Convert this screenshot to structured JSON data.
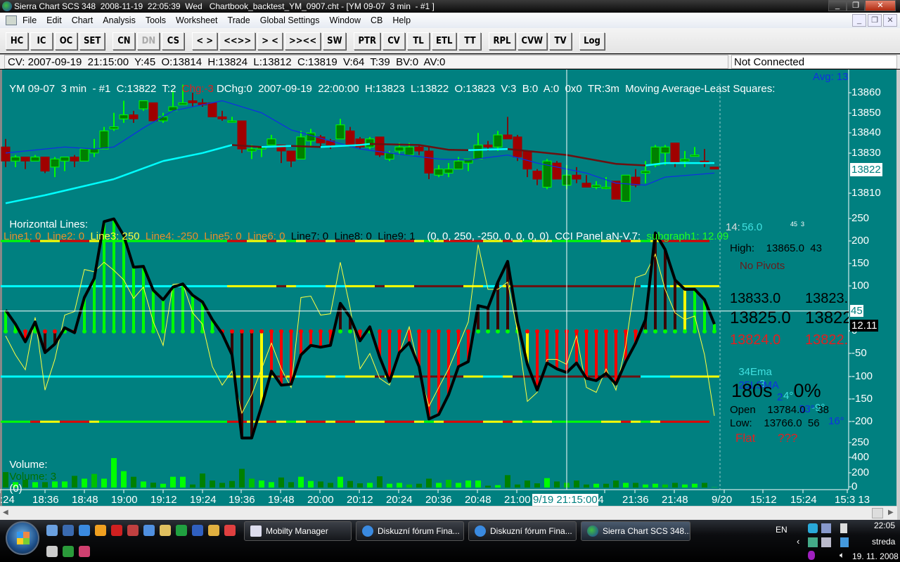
{
  "window": {
    "title": "Sierra Chart SCS 348  2008-11-19  22:05:39  Wed   Chartbook_backtest_YM_0907.cht - [YM 09-07  3 min  - #1 ]",
    "buttons": {
      "minimize": "_",
      "restore": "❐",
      "close": "✕"
    }
  },
  "menu": [
    "File",
    "Edit",
    "Chart",
    "Analysis",
    "Tools",
    "Worksheet",
    "Trade",
    "Global Settings",
    "Window",
    "CB",
    "Help"
  ],
  "mdi_buttons": [
    "_",
    "❐",
    "✕"
  ],
  "toolbar": [
    {
      "label": "HC"
    },
    {
      "label": "IC"
    },
    {
      "label": "OC"
    },
    {
      "label": "SET"
    },
    {
      "label": "CN",
      "group": true
    },
    {
      "label": "DN",
      "disabled": true
    },
    {
      "label": "CS"
    },
    {
      "label": "< >",
      "group": true
    },
    {
      "label": "<<>>"
    },
    {
      "label": "> <"
    },
    {
      "label": ">><<"
    },
    {
      "label": "SW"
    },
    {
      "label": "PTR",
      "group": true
    },
    {
      "label": "CV"
    },
    {
      "label": "TL"
    },
    {
      "label": "ETL"
    },
    {
      "label": "TT"
    },
    {
      "label": "RPL",
      "group": true
    },
    {
      "label": "CVW"
    },
    {
      "label": "TV"
    },
    {
      "label": "Log",
      "group": true
    }
  ],
  "infobar": {
    "cursor_values": "CV: 2007-09-19  21:15:00  Y:45  O:13814  H:13824  L:13812  C:13819  V:64  T:39  BV:0  AV:0",
    "connection_status": "Not Connected"
  },
  "price_header": {
    "main": "YM 09-07  3 min  - #1  C:13822  T:2  ",
    "change": "Chg:-3",
    "rest": " DChg:0  2007-09-19  22:00:00  H:13823  L:13822  O:13823  V:3  B:0  A:0  0x0  TR:3m  Moving Average-Least Squares:  ",
    "avg": "Avg: 13"
  },
  "cci_header": {
    "label": "Horizontal Lines:  ",
    "lines": [
      {
        "text": "Line1: 0",
        "color": "#e8902a"
      },
      {
        "text": "Line2: 0",
        "color": "#e8902a"
      },
      {
        "text": "Line3: 250",
        "color": "#ffff40"
      },
      {
        "text": "Line4: -250",
        "color": "#e8902a"
      },
      {
        "text": "Line5: 0",
        "color": "#e8902a"
      },
      {
        "text": "Line6: 0",
        "color": "#e8902a"
      },
      {
        "text": "Line7: 0",
        "color": "#000000"
      },
      {
        "text": "Line8: 0",
        "color": "#000000"
      },
      {
        "text": "Line9: 1",
        "color": "#000000"
      }
    ],
    "tuple": "(0, 0, 250, -250, 0, 0, 0, 0)",
    "panel": "CCI Panel aN-V.7:",
    "subgraph": "subgraph1: 12.09"
  },
  "volume_header": {
    "label": "Volume:",
    "series": "Volume: 3",
    "extra": "(0)"
  },
  "overlay": {
    "timer_a": "14:",
    "timer_b": "56.0",
    "small": "45  3",
    "high": "High:    13865.0  43",
    "pivots": "No Pivots",
    "row1": [
      "13833.0",
      "13823."
    ],
    "row2": [
      "13825.0",
      "13822"
    ],
    "row3": [
      "13824.0",
      "13822."
    ],
    "ema": [
      "34Ema",
      "-3",
      "4°",
      "-9°"
    ],
    "lsma": [
      "25LSMA",
      "2",
      "33°",
      "16°"
    ],
    "timer": "180s    0%",
    "open": "Open    13784.0    38",
    "low": "Low:    13766.0  56",
    "flat": [
      "Flat",
      "???"
    ]
  },
  "axes": {
    "price_ticks": [
      "13860",
      "13850",
      "13840",
      "13830",
      "13810"
    ],
    "price_marker": "13822",
    "cci_ticks": [
      "250",
      "200",
      "150",
      "100",
      "0",
      "-50",
      "-100",
      "-150",
      "-200",
      "250"
    ],
    "cci_cursor_marker": "45",
    "cci_value_marker": "12.11",
    "volume_ticks": [
      "400",
      "200",
      "0"
    ],
    "time_labels": [
      ":24",
      "18:36",
      "18:48",
      "19:00",
      "19:12",
      "19:24",
      "19:36",
      "19:48",
      "20:00",
      "20:12",
      "20:24",
      "20:36",
      "20:48",
      "21:00",
      "24",
      "21:36",
      "21:48",
      "9/20",
      "15:12",
      "15:24",
      "15:3 13"
    ],
    "cursor_time": "9/19 21:15:00"
  },
  "colors": {
    "background": "#008080",
    "up_body": "#008000",
    "up_line": "#00ff00",
    "down_body": "#a00000",
    "down_line": "#7a1010",
    "ema": "#1030e0",
    "lsma_up": "#00ffff",
    "lsma_down": "#6b1010",
    "cci": "#000000",
    "cci_fast": "#ffff40",
    "hist": {
      "g": "#00ff00",
      "r": "#ff0000",
      "k": "#3a0505",
      "y": "#ffff00"
    },
    "levels": {
      "g": "#00ff00",
      "r": "#e00000",
      "y": "#ffff00",
      "c": "#00ffff",
      "m": "#6b1010"
    },
    "volume": {
      "d": "#008000",
      "b": "#00ff00",
      "m": "#00c000"
    }
  },
  "chart_data": {
    "type": "candlestick",
    "symbol": "YM 09-07",
    "interval": "3 min",
    "bars": [
      [
        "18:24",
        13833,
        13837,
        13823,
        13826
      ],
      [
        "18:27",
        13826,
        13829,
        13823,
        13828
      ],
      [
        "18:30",
        13828,
        13828,
        13822,
        13826
      ],
      [
        "18:33",
        13826,
        13829,
        13826,
        13828
      ],
      [
        "18:36",
        13828,
        13828,
        13820,
        13821
      ],
      [
        "18:39",
        13823,
        13828,
        13818,
        13827
      ],
      [
        "18:42",
        13826,
        13828,
        13821,
        13828
      ],
      [
        "18:45",
        13828,
        13829,
        13823,
        13826
      ],
      [
        "18:48",
        13826,
        13832,
        13826,
        13832
      ],
      [
        "18:51",
        13830,
        13837,
        13828,
        13832
      ],
      [
        "18:54",
        13832,
        13843,
        13832,
        13841
      ],
      [
        "18:57",
        13842,
        13850,
        13841,
        13843
      ],
      [
        "19:00",
        13847,
        13856,
        13845,
        13849
      ],
      [
        "19:03",
        13849,
        13851,
        13845,
        13847
      ],
      [
        "19:06",
        13852,
        13856,
        13851,
        13856
      ],
      [
        "19:09",
        13855,
        13855,
        13846,
        13846
      ],
      [
        "19:12",
        13846,
        13850,
        13845,
        13848
      ],
      [
        "19:15",
        13851,
        13861,
        13851,
        13853
      ],
      [
        "19:18",
        13854,
        13864,
        13854,
        13855
      ],
      [
        "19:21",
        13856,
        13860,
        13853,
        13855
      ],
      [
        "19:24",
        13855,
        13857,
        13853,
        13854
      ],
      [
        "19:27",
        13855,
        13855,
        13848,
        13848
      ],
      [
        "19:30",
        13848,
        13851,
        13846,
        13847
      ],
      [
        "19:33",
        13846,
        13848,
        13846,
        13846
      ],
      [
        "19:36",
        13846,
        13846,
        13830,
        13832
      ],
      [
        "19:39",
        13831,
        13834,
        13827,
        13832
      ],
      [
        "19:42",
        13832,
        13833,
        13828,
        13833
      ],
      [
        "19:45",
        13834,
        13839,
        13834,
        13837
      ],
      [
        "19:48",
        13834,
        13834,
        13825,
        13831
      ],
      [
        "19:51",
        13831,
        13831,
        13823,
        13826
      ],
      [
        "19:54",
        13827,
        13841,
        13827,
        13838
      ],
      [
        "19:57",
        13836,
        13842,
        13833,
        13840
      ],
      [
        "20:00",
        13838,
        13839,
        13833,
        13835
      ],
      [
        "20:03",
        13836,
        13837,
        13832,
        13834
      ],
      [
        "20:06",
        13837,
        13847,
        13837,
        13844
      ],
      [
        "20:09",
        13841,
        13843,
        13833,
        13834
      ],
      [
        "20:12",
        13837,
        13838,
        13832,
        13833
      ],
      [
        "20:15",
        13833,
        13838,
        13832,
        13837
      ],
      [
        "20:18",
        13838,
        13838,
        13828,
        13829
      ],
      [
        "20:21",
        13827,
        13831,
        13826,
        13830
      ],
      [
        "20:24",
        13831,
        13835,
        13829,
        13833
      ],
      [
        "20:27",
        13829,
        13835,
        13829,
        13833
      ],
      [
        "20:30",
        13833,
        13834,
        13829,
        13831
      ],
      [
        "20:33",
        13831,
        13833,
        13817,
        13820
      ],
      [
        "20:36",
        13819,
        13824,
        13818,
        13822
      ],
      [
        "20:39",
        13820,
        13825,
        13818,
        13822
      ],
      [
        "20:42",
        13822,
        13828,
        13822,
        13826
      ],
      [
        "20:45",
        13825,
        13827,
        13821,
        13827
      ],
      [
        "20:48",
        13827,
        13840,
        13827,
        13834
      ],
      [
        "20:51",
        13834,
        13836,
        13831,
        13833
      ],
      [
        "20:54",
        13833,
        13841,
        13831,
        13839
      ],
      [
        "20:57",
        13839,
        13848,
        13837,
        13837
      ],
      [
        "21:00",
        13838,
        13839,
        13826,
        13828
      ],
      [
        "21:03",
        13831,
        13831,
        13818,
        13822
      ],
      [
        "21:06",
        13821,
        13822,
        13814,
        13817
      ],
      [
        "21:09",
        13813,
        13827,
        13812,
        13826
      ],
      [
        "21:12",
        13825,
        13826,
        13817,
        13817
      ],
      [
        "21:15",
        13814,
        13824,
        13812,
        13819
      ],
      [
        "21:18",
        13819,
        13823,
        13815,
        13817
      ],
      [
        "21:21",
        13815,
        13819,
        13813,
        13813
      ],
      [
        "21:24",
        13813,
        13816,
        13812,
        13814
      ],
      [
        "21:27",
        13813,
        13818,
        13812,
        13813
      ],
      [
        "21:30",
        13816,
        13816,
        13807,
        13807
      ],
      [
        "21:33",
        13806,
        13819,
        13806,
        13819
      ],
      [
        "21:36",
        13818,
        13822,
        13813,
        13814
      ],
      [
        "21:39",
        13820,
        13826,
        13815,
        13821
      ],
      [
        "21:42",
        13824,
        13834,
        13823,
        13833
      ],
      [
        "21:45",
        13830,
        13834,
        13824,
        13833
      ],
      [
        "21:48",
        13835,
        13835,
        13823,
        13825
      ],
      [
        "21:51",
        13826,
        13831,
        13823,
        13827
      ],
      [
        "21:54",
        13829,
        13833,
        13829,
        13829
      ],
      [
        "21:57",
        13826,
        13832,
        13823,
        13825
      ],
      [
        "22:00",
        13823,
        13823,
        13822,
        13822
      ]
    ],
    "ema_line": [
      [
        "18:24",
        13830
      ],
      [
        "18:42",
        13833
      ],
      [
        "18:51",
        13832
      ],
      [
        "18:57",
        13833
      ],
      [
        "19:06",
        13842.5
      ],
      [
        "19:15",
        13851
      ],
      [
        "19:24",
        13854
      ],
      [
        "19:30",
        13856
      ],
      [
        "19:42",
        13850
      ],
      [
        "19:51",
        13841.5
      ],
      [
        "20:03",
        13836
      ],
      [
        "20:12",
        13832
      ],
      [
        "20:21",
        13830
      ],
      [
        "20:36",
        13827
      ],
      [
        "20:45",
        13826.5
      ],
      [
        "20:57",
        13829
      ],
      [
        "21:06",
        13825
      ],
      [
        "21:21",
        13820
      ],
      [
        "21:30",
        13815
      ],
      [
        "21:39",
        13814
      ],
      [
        "21:45",
        13818
      ],
      [
        "22:00",
        13820
      ]
    ],
    "lsma_line": [
      [
        "18:24",
        13805
      ],
      [
        "18:36",
        13809
      ],
      [
        "18:57",
        13817
      ],
      [
        "19:12",
        13826
      ],
      [
        "19:24",
        13830
      ],
      [
        "19:33",
        13834
      ],
      [
        "19:42",
        13833
      ],
      [
        "19:51",
        13833.5
      ],
      [
        "20:00",
        13833
      ],
      [
        "20:12",
        13834
      ],
      [
        "20:15",
        13834.5
      ],
      [
        "20:30",
        13834
      ],
      [
        "20:39",
        13831.6
      ],
      [
        "20:45",
        13831.4
      ],
      [
        "20:57",
        13832
      ],
      [
        "21:15",
        13829
      ],
      [
        "21:30",
        13824.6
      ],
      [
        "21:39",
        13823.8
      ],
      [
        "21:45",
        13825
      ],
      [
        "21:57",
        13825
      ],
      [
        "22:00",
        13825
      ]
    ],
    "price_range": [
      13800,
      13872
    ],
    "cci": [
      47,
      16,
      -23,
      21,
      -47,
      -28,
      8,
      -3,
      75,
      117,
      243,
      249,
      212,
      142,
      144,
      91,
      70,
      98,
      105,
      80,
      65,
      26,
      -5,
      -52,
      -236,
      -236,
      -166,
      -88,
      -119,
      -117,
      -52,
      -31,
      -35,
      -31,
      62,
      31,
      -21,
      10,
      -57,
      -111,
      -47,
      -25,
      -78,
      -194,
      -184,
      -140,
      -78,
      -67,
      57,
      52,
      109,
      155,
      21,
      -73,
      -130,
      -70,
      -83,
      -91,
      -70,
      -104,
      -109,
      -93,
      -117,
      -67,
      -26,
      26,
      218,
      181,
      114,
      93,
      93,
      70,
      16
    ],
    "cci_hist_colors": "ggrgkkgrggggggggggggggrkkkyrrrrrrrkkrgrrrrrrrrrrkkkkyyrrrrrrrrrrrkkkkyggg",
    "cci_fast": [
      -10,
      -52,
      -85,
      31,
      -130,
      -62,
      36,
      44,
      137,
      132,
      153,
      135,
      114,
      73,
      98,
      21,
      -31,
      104,
      106,
      41,
      16,
      -78,
      -119,
      -88,
      -181,
      -140,
      -83,
      -26,
      -83,
      -124,
      75,
      78,
      36,
      39,
      153,
      52,
      -83,
      -49,
      -104,
      -119,
      -47,
      10,
      -83,
      -166,
      -124,
      -83,
      -31,
      21,
      192,
      93,
      93,
      109,
      0,
      -155,
      -135,
      -62,
      -62,
      -73,
      -10,
      -124,
      -135,
      -83,
      -130,
      -31,
      119,
      127,
      171,
      93,
      41,
      26,
      34,
      -52,
      -187
    ],
    "cci_range": [
      -260,
      260
    ],
    "cci_levels": [
      200,
      100,
      -100,
      -200
    ],
    "level_200_colors": "gggryyrrrygggggggggggggrryyrygyrryrryyyrrrygyrrrryyrygyygggggyyrygyrrrrr",
    "level_100_colors": "cccccccccccccccccccccccyyyyymycccycyyymyyymmmmmyyccymmmmmmmmmmmmmcccyyyyy",
    "volume": [
      209,
      73,
      105,
      73,
      73,
      82,
      82,
      158,
      120,
      184,
      120,
      399,
      222,
      146,
      82,
      66,
      51,
      146,
      146,
      41,
      190,
      95,
      63,
      89,
      253,
      120,
      95,
      73,
      136,
      73,
      146,
      89,
      82,
      63,
      146,
      89,
      57,
      63,
      152,
      51,
      63,
      41,
      51,
      120,
      63,
      105,
      63,
      95,
      95,
      25,
      32,
      168,
      41,
      95,
      57,
      127,
      82,
      64,
      95,
      41,
      51,
      51,
      95,
      63,
      63,
      41,
      51,
      41,
      63,
      41,
      51,
      63,
      3
    ],
    "volume_colors": "dbdbdbbdbmbbbdbdbbbddddddmbbddbbddbddbdbbmddbmbbbdbddddbdmddbddbdbbmdbbdb",
    "volume_range": [
      0,
      500
    ],
    "cursor_bar": "21:15"
  }
}
